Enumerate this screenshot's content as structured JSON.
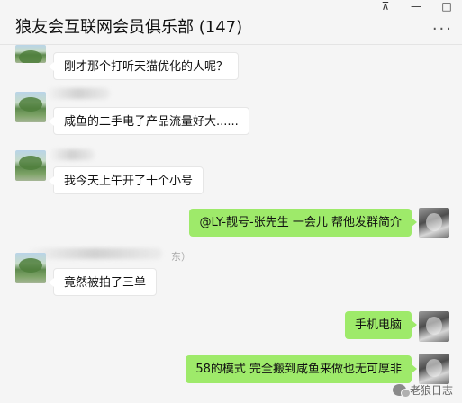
{
  "window": {
    "title": "狼友会互联网会员俱乐部 (147)",
    "pin_icon": "pin-icon",
    "pin_symbol": "⊼",
    "minimize_symbol": "—",
    "maximize_symbol": "□",
    "more_symbol": "···"
  },
  "messages": [
    {
      "direction": "in",
      "text": "刚才那个打听天猫优化的人呢？"
    },
    {
      "direction": "in",
      "text": "咸鱼的二手电子产品流量好大......"
    },
    {
      "direction": "in",
      "text": "我今天上午开了十个小号"
    },
    {
      "direction": "out",
      "text": "@LY-靓号-张先生 一会儿 帮他发群简介"
    },
    {
      "direction": "in",
      "text": "竟然被拍了三单",
      "sender_suffix": "东）"
    },
    {
      "direction": "out",
      "text": "手机电脑"
    },
    {
      "direction": "out",
      "text": "58的模式 完全搬到咸鱼来做也无可厚非"
    }
  ],
  "watermark": {
    "text": "老狼日志",
    "icon": "wechat-official-account-icon"
  },
  "colors": {
    "outgoing_bubble": "#9eea6a",
    "incoming_bubble": "#ffffff",
    "background": "#f5f5f5"
  }
}
